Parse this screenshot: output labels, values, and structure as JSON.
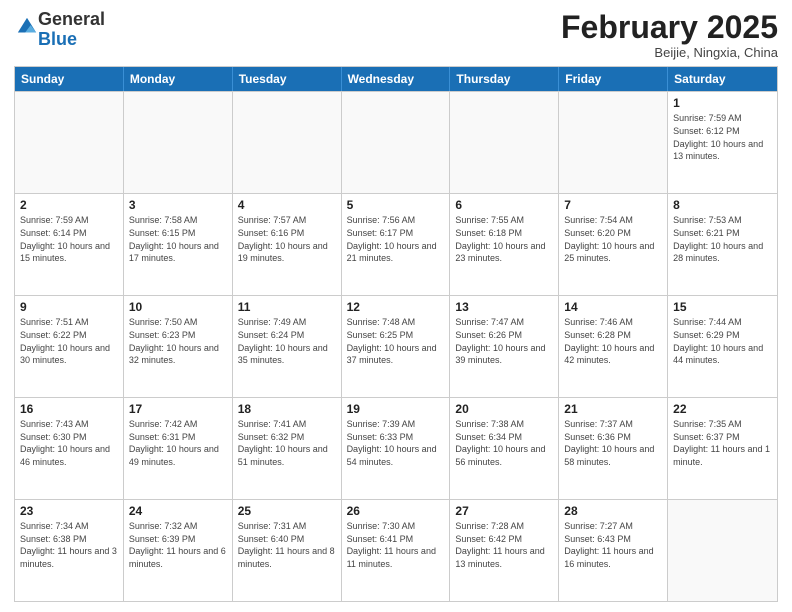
{
  "logo": {
    "general": "General",
    "blue": "Blue"
  },
  "title": "February 2025",
  "location": "Beijie, Ningxia, China",
  "header_days": [
    "Sunday",
    "Monday",
    "Tuesday",
    "Wednesday",
    "Thursday",
    "Friday",
    "Saturday"
  ],
  "weeks": [
    [
      {
        "day": "",
        "text": ""
      },
      {
        "day": "",
        "text": ""
      },
      {
        "day": "",
        "text": ""
      },
      {
        "day": "",
        "text": ""
      },
      {
        "day": "",
        "text": ""
      },
      {
        "day": "",
        "text": ""
      },
      {
        "day": "1",
        "text": "Sunrise: 7:59 AM\nSunset: 6:12 PM\nDaylight: 10 hours and 13 minutes."
      }
    ],
    [
      {
        "day": "2",
        "text": "Sunrise: 7:59 AM\nSunset: 6:14 PM\nDaylight: 10 hours and 15 minutes."
      },
      {
        "day": "3",
        "text": "Sunrise: 7:58 AM\nSunset: 6:15 PM\nDaylight: 10 hours and 17 minutes."
      },
      {
        "day": "4",
        "text": "Sunrise: 7:57 AM\nSunset: 6:16 PM\nDaylight: 10 hours and 19 minutes."
      },
      {
        "day": "5",
        "text": "Sunrise: 7:56 AM\nSunset: 6:17 PM\nDaylight: 10 hours and 21 minutes."
      },
      {
        "day": "6",
        "text": "Sunrise: 7:55 AM\nSunset: 6:18 PM\nDaylight: 10 hours and 23 minutes."
      },
      {
        "day": "7",
        "text": "Sunrise: 7:54 AM\nSunset: 6:20 PM\nDaylight: 10 hours and 25 minutes."
      },
      {
        "day": "8",
        "text": "Sunrise: 7:53 AM\nSunset: 6:21 PM\nDaylight: 10 hours and 28 minutes."
      }
    ],
    [
      {
        "day": "9",
        "text": "Sunrise: 7:51 AM\nSunset: 6:22 PM\nDaylight: 10 hours and 30 minutes."
      },
      {
        "day": "10",
        "text": "Sunrise: 7:50 AM\nSunset: 6:23 PM\nDaylight: 10 hours and 32 minutes."
      },
      {
        "day": "11",
        "text": "Sunrise: 7:49 AM\nSunset: 6:24 PM\nDaylight: 10 hours and 35 minutes."
      },
      {
        "day": "12",
        "text": "Sunrise: 7:48 AM\nSunset: 6:25 PM\nDaylight: 10 hours and 37 minutes."
      },
      {
        "day": "13",
        "text": "Sunrise: 7:47 AM\nSunset: 6:26 PM\nDaylight: 10 hours and 39 minutes."
      },
      {
        "day": "14",
        "text": "Sunrise: 7:46 AM\nSunset: 6:28 PM\nDaylight: 10 hours and 42 minutes."
      },
      {
        "day": "15",
        "text": "Sunrise: 7:44 AM\nSunset: 6:29 PM\nDaylight: 10 hours and 44 minutes."
      }
    ],
    [
      {
        "day": "16",
        "text": "Sunrise: 7:43 AM\nSunset: 6:30 PM\nDaylight: 10 hours and 46 minutes."
      },
      {
        "day": "17",
        "text": "Sunrise: 7:42 AM\nSunset: 6:31 PM\nDaylight: 10 hours and 49 minutes."
      },
      {
        "day": "18",
        "text": "Sunrise: 7:41 AM\nSunset: 6:32 PM\nDaylight: 10 hours and 51 minutes."
      },
      {
        "day": "19",
        "text": "Sunrise: 7:39 AM\nSunset: 6:33 PM\nDaylight: 10 hours and 54 minutes."
      },
      {
        "day": "20",
        "text": "Sunrise: 7:38 AM\nSunset: 6:34 PM\nDaylight: 10 hours and 56 minutes."
      },
      {
        "day": "21",
        "text": "Sunrise: 7:37 AM\nSunset: 6:36 PM\nDaylight: 10 hours and 58 minutes."
      },
      {
        "day": "22",
        "text": "Sunrise: 7:35 AM\nSunset: 6:37 PM\nDaylight: 11 hours and 1 minute."
      }
    ],
    [
      {
        "day": "23",
        "text": "Sunrise: 7:34 AM\nSunset: 6:38 PM\nDaylight: 11 hours and 3 minutes."
      },
      {
        "day": "24",
        "text": "Sunrise: 7:32 AM\nSunset: 6:39 PM\nDaylight: 11 hours and 6 minutes."
      },
      {
        "day": "25",
        "text": "Sunrise: 7:31 AM\nSunset: 6:40 PM\nDaylight: 11 hours and 8 minutes."
      },
      {
        "day": "26",
        "text": "Sunrise: 7:30 AM\nSunset: 6:41 PM\nDaylight: 11 hours and 11 minutes."
      },
      {
        "day": "27",
        "text": "Sunrise: 7:28 AM\nSunset: 6:42 PM\nDaylight: 11 hours and 13 minutes."
      },
      {
        "day": "28",
        "text": "Sunrise: 7:27 AM\nSunset: 6:43 PM\nDaylight: 11 hours and 16 minutes."
      },
      {
        "day": "",
        "text": ""
      }
    ]
  ]
}
